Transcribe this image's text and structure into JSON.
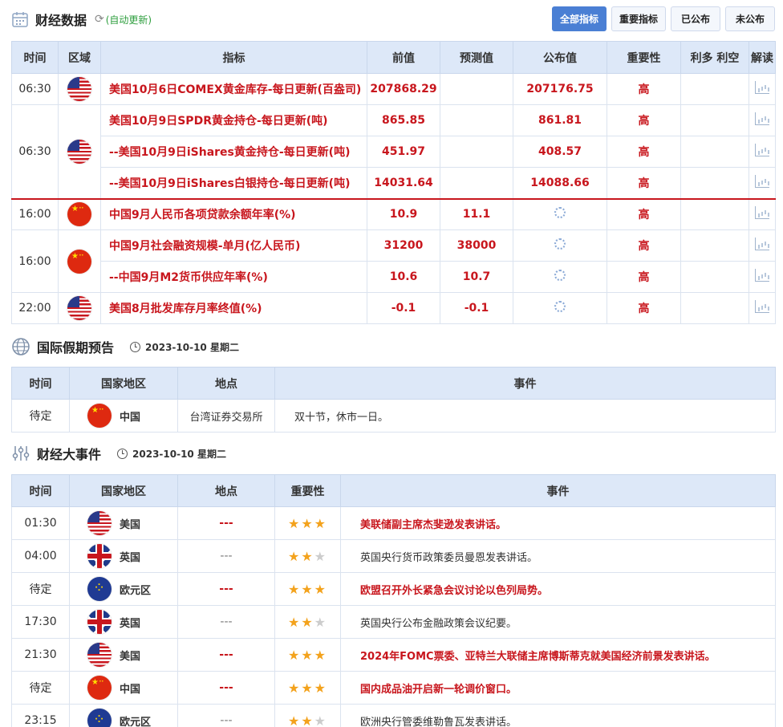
{
  "header": {
    "title": "财经数据",
    "auto_update": "(自动更新)",
    "filters": [
      "全部指标",
      "重要指标",
      "已公布",
      "未公布"
    ]
  },
  "data_table": {
    "columns": [
      "时间",
      "区域",
      "指标",
      "前值",
      "预测值",
      "公布值",
      "重要性",
      "利多 利空",
      "解读"
    ],
    "rows": [
      {
        "time": "06:30",
        "flag": "us",
        "indicator": "美国10月6日COMEX黄金库存-每日更新(百盎司)",
        "prev": "207868.29",
        "forecast": "",
        "actual": "207176.75",
        "importance": "高"
      },
      {
        "time": "06:30",
        "flag": "us",
        "indicator": "美国10月9日SPDR黄金持仓-每日更新(吨)",
        "prev": "865.85",
        "forecast": "",
        "actual": "861.81",
        "importance": "高"
      },
      {
        "time": "",
        "flag": "",
        "indicator": "--美国10月9日iShares黄金持仓-每日更新(吨)",
        "prev": "451.97",
        "forecast": "",
        "actual": "408.57",
        "importance": "高"
      },
      {
        "time": "",
        "flag": "",
        "indicator": "--美国10月9日iShares白银持仓-每日更新(吨)",
        "prev": "14031.64",
        "forecast": "",
        "actual": "14088.66",
        "importance": "高"
      },
      {
        "time": "16:00",
        "flag": "cn",
        "indicator": "中国9月人民币各项贷款余额年率(%)",
        "prev": "10.9",
        "forecast": "11.1",
        "actual": "",
        "importance": "高"
      },
      {
        "time": "16:00",
        "flag": "cn",
        "indicator": "中国9月社会融资规模-单月(亿人民币)",
        "prev": "31200",
        "forecast": "38000",
        "actual": "",
        "importance": "高"
      },
      {
        "time": "",
        "flag": "",
        "indicator": "--中国9月M2货币供应年率(%)",
        "prev": "10.6",
        "forecast": "10.7",
        "actual": "",
        "importance": "高"
      },
      {
        "time": "22:00",
        "flag": "us",
        "indicator": "美国8月批发库存月率终值(%)",
        "prev": "-0.1",
        "forecast": "-0.1",
        "actual": "",
        "importance": "高"
      }
    ]
  },
  "holiday": {
    "title": "国际假期预告",
    "date": "2023-10-10 星期二",
    "columns": [
      "时间",
      "国家地区",
      "地点",
      "事件"
    ],
    "rows": [
      {
        "time": "待定",
        "flag": "cn",
        "country": "中国",
        "place": "台湾证券交易所",
        "event": "双十节，休市一日。"
      }
    ]
  },
  "events": {
    "title": "财经大事件",
    "date": "2023-10-10 星期二",
    "columns": [
      "时间",
      "国家地区",
      "地点",
      "重要性",
      "事件"
    ],
    "rows": [
      {
        "time": "01:30",
        "flag": "us",
        "country": "美国",
        "place": "---",
        "stars": 3,
        "event": "美联储副主席杰斐逊发表讲话。"
      },
      {
        "time": "04:00",
        "flag": "uk",
        "country": "英国",
        "place": "---",
        "stars": 2,
        "event": "英国央行货币政策委员曼恩发表讲话。"
      },
      {
        "time": "待定",
        "flag": "eu",
        "country": "欧元区",
        "place": "---",
        "stars": 3,
        "event": "欧盟召开外长紧急会议讨论以色列局势。"
      },
      {
        "time": "17:30",
        "flag": "uk",
        "country": "英国",
        "place": "---",
        "stars": 2,
        "event": "英国央行公布金融政策会议纪要。"
      },
      {
        "time": "21:30",
        "flag": "us",
        "country": "美国",
        "place": "---",
        "stars": 3,
        "event": "2024年FOMC票委、亚特兰大联储主席博斯蒂克就美国经济前景发表讲话。"
      },
      {
        "time": "待定",
        "flag": "cn",
        "country": "中国",
        "place": "---",
        "stars": 3,
        "event": "国内成品油开启新一轮调价窗口。"
      },
      {
        "time": "23:15",
        "flag": "eu",
        "country": "欧元区",
        "place": "---",
        "stars": 2,
        "event": "欧洲央行管委维勒鲁瓦发表讲话。"
      }
    ]
  }
}
